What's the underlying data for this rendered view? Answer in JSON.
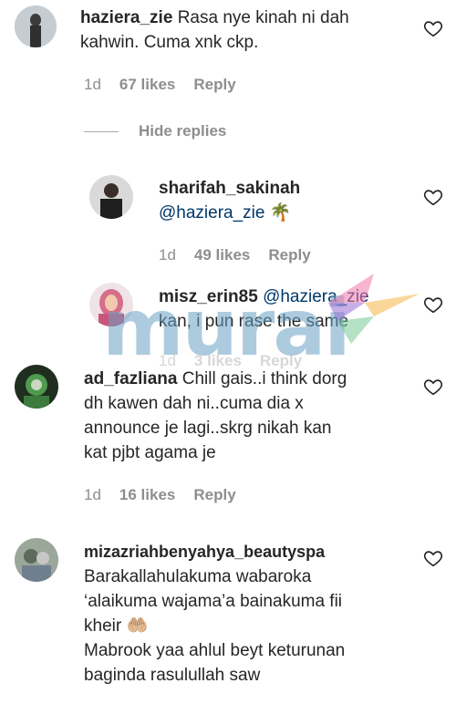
{
  "comments": [
    {
      "username": "haziera_zie",
      "text_line1": "Rasa nye kinah ni dah",
      "text_line2": "kahwin. Cuma xnk ckp.",
      "time": "1d",
      "likes": "67 likes",
      "reply": "Reply"
    },
    {
      "username": "ad_fazliana",
      "text_line1": "Chill gais..i think dorg",
      "text_line2": "dh kawen dah ni..cuma dia x",
      "text_line3": "announce je lagi..skrg nikah kan",
      "text_line4": "kat pjbt agama je",
      "time": "1d",
      "likes": "16 likes",
      "reply": "Reply"
    },
    {
      "username": "mizazriahbenyahya_beautyspa",
      "text_line1": "Barakallahulakuma wabaroka",
      "text_line2": "‘alaikuma wajama’a bainakuma fii",
      "text_line3": "kheir",
      "text_line3_emoji": "🤲🏼",
      "text_line4": "Mabrook yaa ahlul beyt keturunan",
      "text_line5": "baginda rasulullah saw"
    }
  ],
  "hide_replies": "Hide replies",
  "replies": [
    {
      "username": "sharifah_sakinah",
      "mention": "@haziera_zie",
      "emoji": "🌴",
      "time": "1d",
      "likes": "49 likes",
      "reply": "Reply"
    },
    {
      "username": "misz_erin85",
      "mention": "@haziera_zie",
      "text_line2": "kan, i pun rase the same",
      "time": "1d",
      "likes": "3 likes",
      "reply": "Reply"
    }
  ],
  "watermark": "murai",
  "colors": {
    "text": "#262626",
    "meta": "#8e8e8e",
    "mention": "#00376b",
    "watermark": "#69a0c3"
  },
  "icons": [
    "heart-icon"
  ]
}
